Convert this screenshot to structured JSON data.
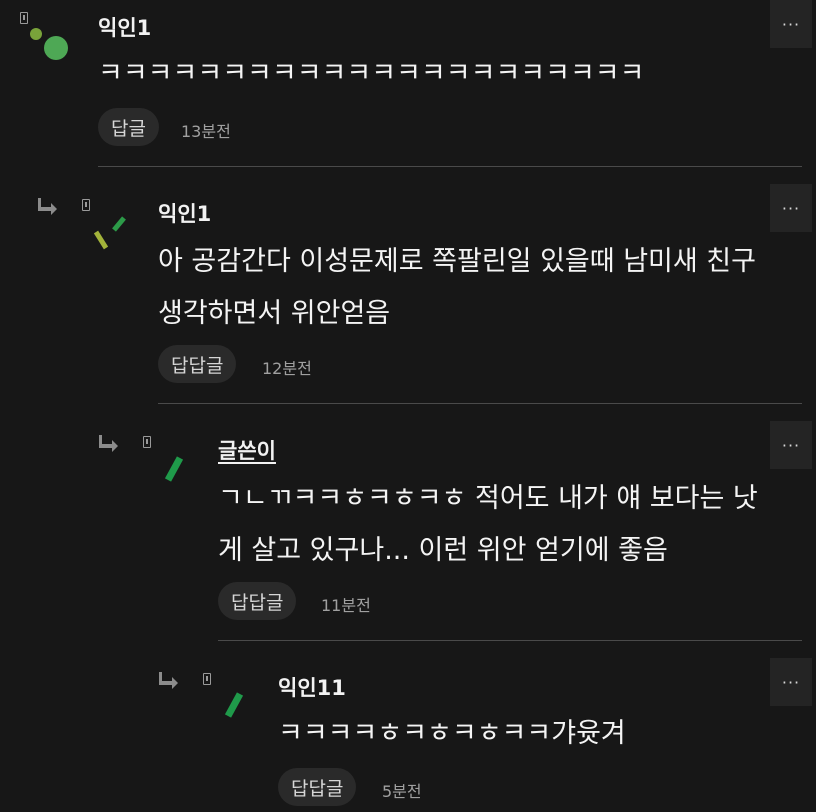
{
  "more_label": "···",
  "comments": [
    {
      "author": "익인1",
      "lines": [
        "ㅋㅋㅋㅋㅋㅋㅋㅋㅋㅋㅋㅋㅋㅋㅋㅋㅋㅋㅋㅋㅋㅋ"
      ],
      "reply_label": "답글",
      "time": "13분전"
    },
    {
      "author": "익인1",
      "lines": [
        "아 공감간다 이성문제로 쪽팔린일 있을때 남미새 친구",
        "생각하면서 위안얻음"
      ],
      "reply_label": "답답글",
      "time": "12분전"
    },
    {
      "author": "글쓴이",
      "lines": [
        "ㄱㄴㄲㅋㅋㅎㅋㅎㅋㅎ 적어도 내가 얘 보다는 낫",
        "게 살고 있구나... 이런 위안 얻기에 좋음"
      ],
      "reply_label": "답답글",
      "time": "11분전"
    },
    {
      "author": "익인11",
      "lines": [
        "ㅋㅋㅋㅋㅎㅋㅎㅋㅎㅋㅋ갸윳겨"
      ],
      "reply_label": "답답글",
      "time": "5분전"
    }
  ],
  "colors": {
    "background": "#171717",
    "avatar_green_light": "#6fae45",
    "avatar_green_dark": "#1f8a4a",
    "avatar_olive": "#a3b33a"
  }
}
